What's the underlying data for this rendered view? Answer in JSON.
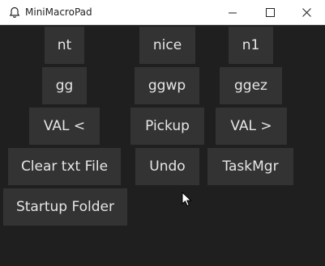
{
  "window": {
    "title": "MiniMacroPad",
    "app_icon": "bell-icon",
    "controls": [
      "minimize-icon",
      "maximize-icon",
      "close-icon"
    ]
  },
  "colors": {
    "background": "#1f1f1f",
    "button_bg": "#333333",
    "button_text": "#e6e6e6",
    "titlebar_bg": "#ffffff"
  },
  "macros": {
    "nt": "nt",
    "nice": "nice",
    "n1": "n1",
    "gg": "gg",
    "ggwp": "ggwp",
    "ggez": "ggez",
    "val_left": "VAL <",
    "pickup": "Pickup",
    "val_right": "VAL >",
    "clear_txt": "Clear txt File",
    "undo": "Undo",
    "taskmgr": "TaskMgr",
    "startup_folder": "Startup Folder"
  }
}
